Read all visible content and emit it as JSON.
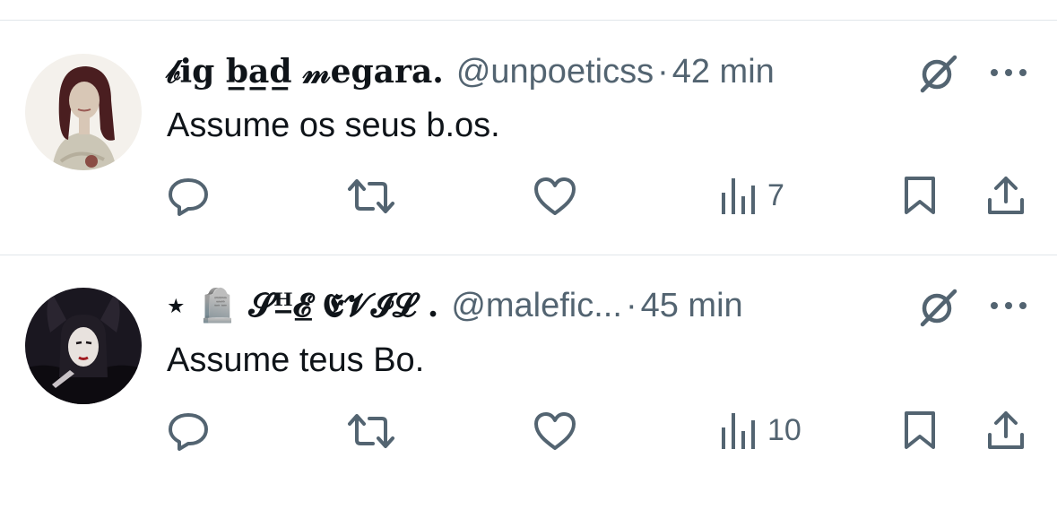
{
  "tweets": [
    {
      "display_name": "𝒷ig  b̲a̲d̲ 𝓂egara.",
      "handle": "@unpoeticss",
      "separator": "·",
      "time": "42 min",
      "text": "Assume os seus b.os.",
      "views": "7"
    },
    {
      "display_name": "⋆ 🪦   𝓢ᴴ̲𝓔̲   𝕰𝓥𝓘𝓛  .",
      "handle": "@malefic...",
      "separator": "·",
      "time": "45 min",
      "text": "Assume teus Bo.",
      "views": "10"
    }
  ],
  "colors": {
    "text": "#0f1419",
    "secondary": "#536471",
    "divider": "#e1e6ea"
  },
  "icons": {
    "reply": "reply-icon",
    "retweet": "retweet-icon",
    "like": "heart-icon",
    "views": "views-chart-icon",
    "bookmark": "bookmark-icon",
    "share": "share-icon",
    "grok": "grok-icon",
    "more": "more-icon"
  }
}
